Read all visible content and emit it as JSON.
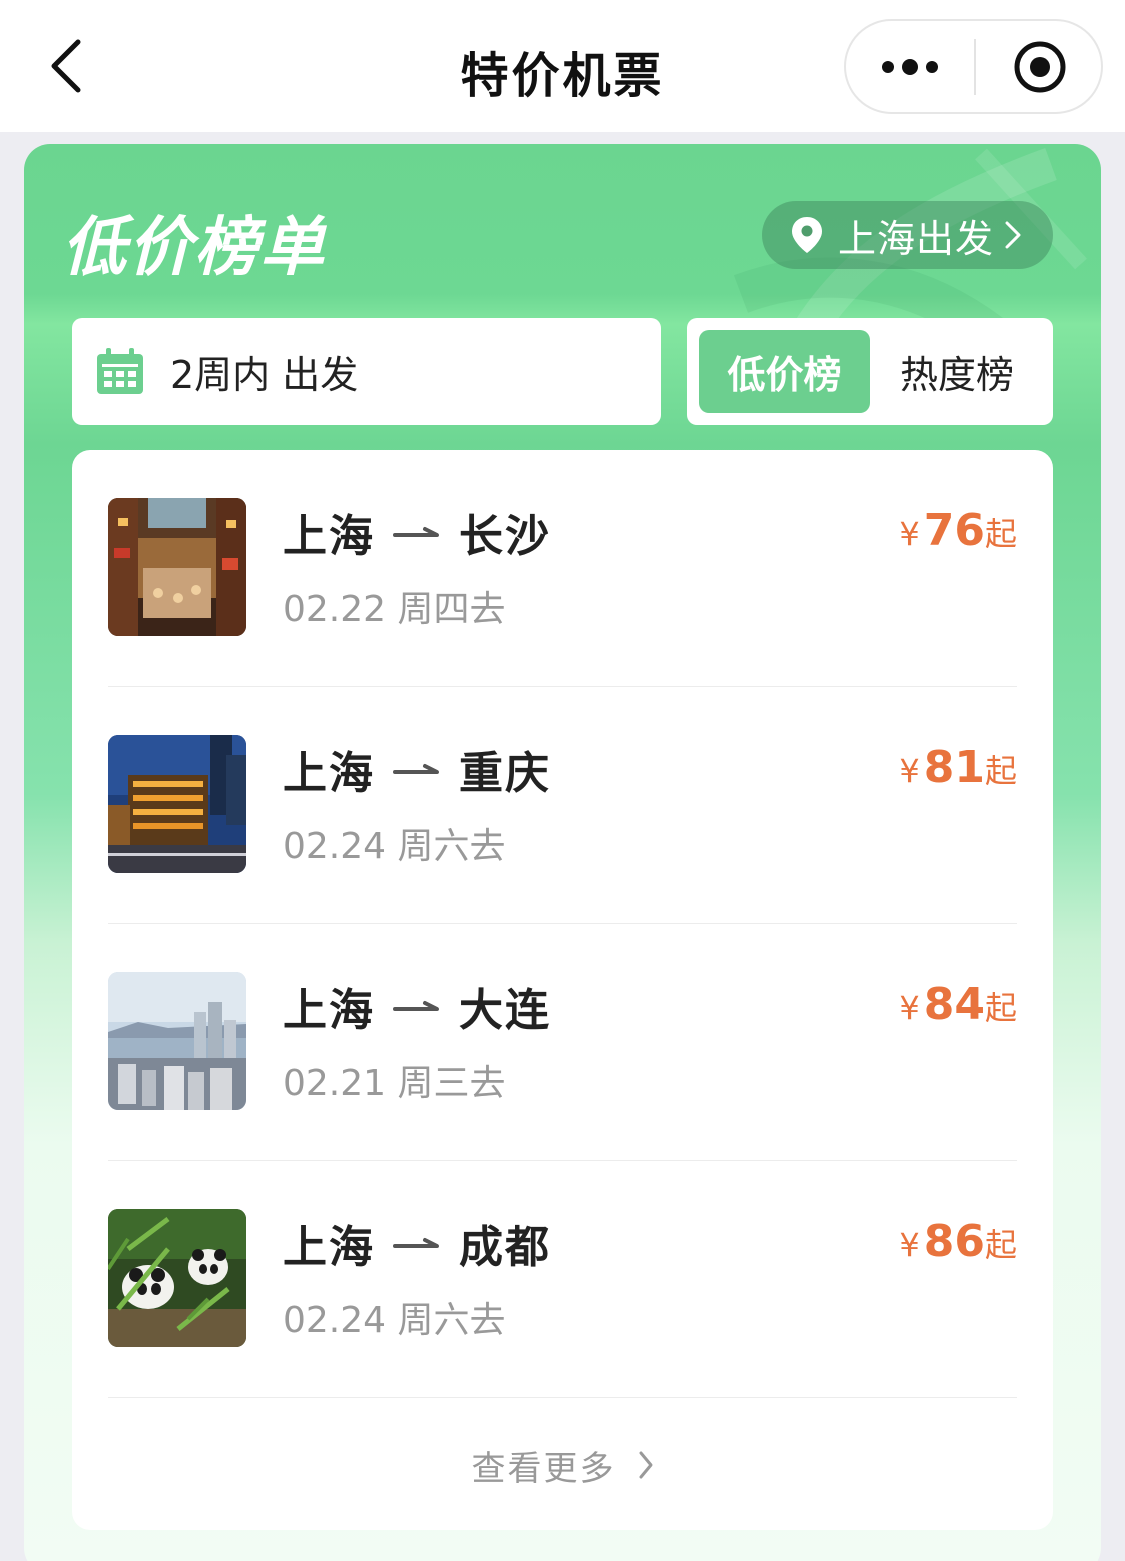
{
  "navbar": {
    "title": "特价机票"
  },
  "panel": {
    "title": "低价榜单",
    "departure_city": "上海出发",
    "date_filter": "2周内 出发",
    "tabs": [
      {
        "label": "低价榜",
        "active": true
      },
      {
        "label": "热度榜",
        "active": false
      }
    ]
  },
  "routes": [
    {
      "from": "上海",
      "to": "长沙",
      "date": "02.22 周四去",
      "currency": "¥",
      "price": "76",
      "suffix": "起",
      "image": "changsha-street-photo"
    },
    {
      "from": "上海",
      "to": "重庆",
      "date": "02.24 周六去",
      "currency": "¥",
      "price": "81",
      "suffix": "起",
      "image": "chongqing-night-photo"
    },
    {
      "from": "上海",
      "to": "大连",
      "date": "02.21 周三去",
      "currency": "¥",
      "price": "84",
      "suffix": "起",
      "image": "dalian-skyline-photo"
    },
    {
      "from": "上海",
      "to": "成都",
      "date": "02.24 周六去",
      "currency": "¥",
      "price": "86",
      "suffix": "起",
      "image": "chengdu-panda-photo"
    }
  ],
  "more_label": "查看更多",
  "colors": {
    "accent_green": "#6ccf8f",
    "price_orange": "#e8733d",
    "muted_text": "#999999"
  }
}
